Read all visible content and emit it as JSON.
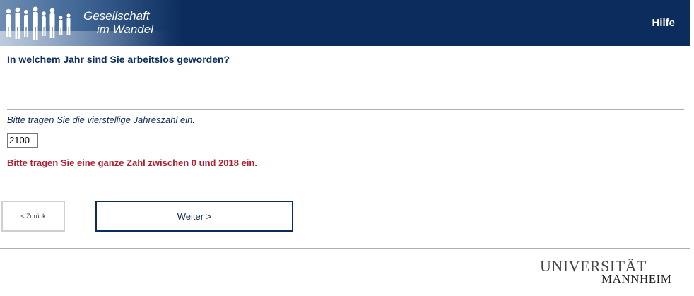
{
  "header": {
    "logo_line1": "Gesellschaft",
    "logo_line2": "im Wandel",
    "help_label": "Hilfe",
    "background_color": "#0b2c5d"
  },
  "question": {
    "text": "In welchem Jahr sind Sie arbeitslos geworden?",
    "instruction": "Bitte tragen Sie die vierstellige Jahreszahl ein."
  },
  "input": {
    "value": "2100"
  },
  "error": {
    "text": "Bitte tragen Sie eine ganze Zahl zwischen 0 und 2018 ein.",
    "color": "#b01c2e"
  },
  "navigation": {
    "back_label": "< Zurück",
    "next_label": "Weiter >"
  },
  "footer": {
    "logo_line1": "UNIVERSITÄT",
    "logo_line2": "MANNHEIM"
  }
}
